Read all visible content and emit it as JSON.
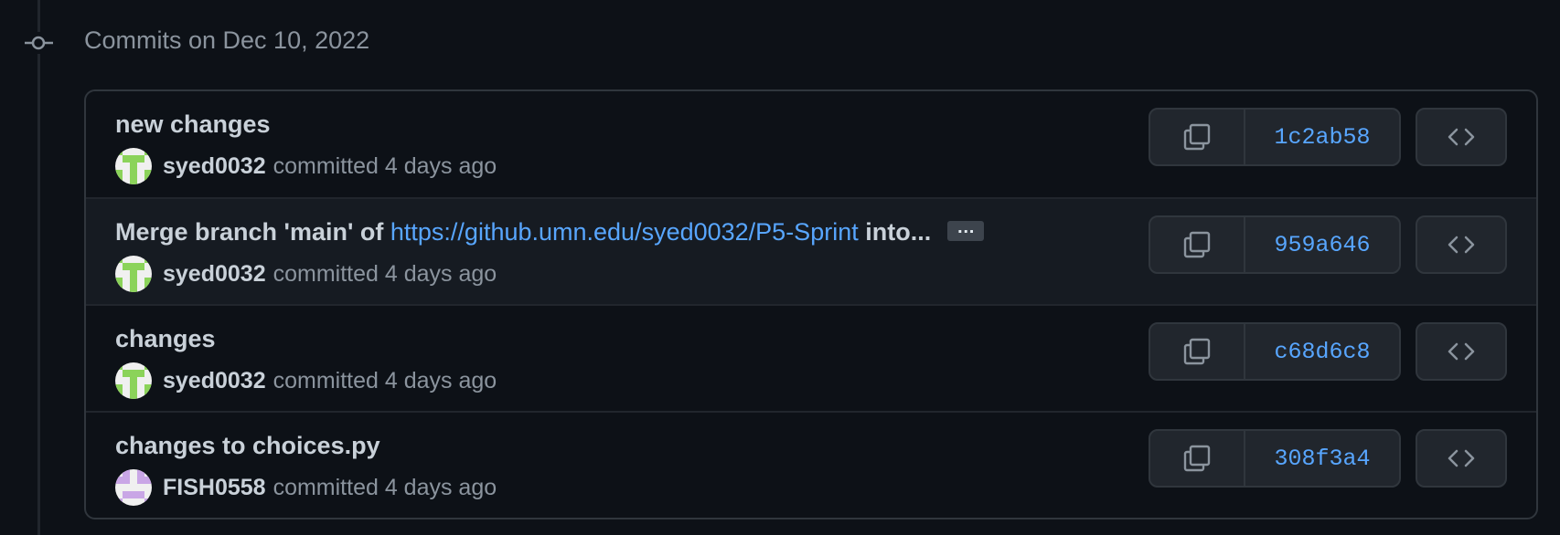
{
  "group": {
    "title": "Commits on Dec 10, 2022",
    "icon": "git-commit-icon"
  },
  "commits": [
    {
      "title": "new changes",
      "author": "syed0032",
      "committed_text": "committed 4 days ago",
      "sha": "1c2ab58",
      "avatar_color": "#8bd35a"
    },
    {
      "title_prefix": "Merge branch 'main' of ",
      "title_link": "https://github.umn.edu/syed0032/P5-Sprint",
      "title_suffix": " into...",
      "ellipsis": "…",
      "author": "syed0032",
      "committed_text": "committed 4 days ago",
      "sha": "959a646",
      "avatar_color": "#8bd35a"
    },
    {
      "title": "changes",
      "author": "syed0032",
      "committed_text": "committed 4 days ago",
      "sha": "c68d6c8",
      "avatar_color": "#8bd35a"
    },
    {
      "title": "changes to choices.py",
      "author": "FISH0558",
      "committed_text": "committed 4 days ago",
      "sha": "308f3a4",
      "avatar_color": "#c9a6e6"
    }
  ],
  "colors": {
    "background": "#0d1117",
    "row_alt": "#161b22",
    "border": "#30363d",
    "link": "#58a6ff",
    "muted": "#8b949e",
    "text": "#c9d1d9"
  }
}
